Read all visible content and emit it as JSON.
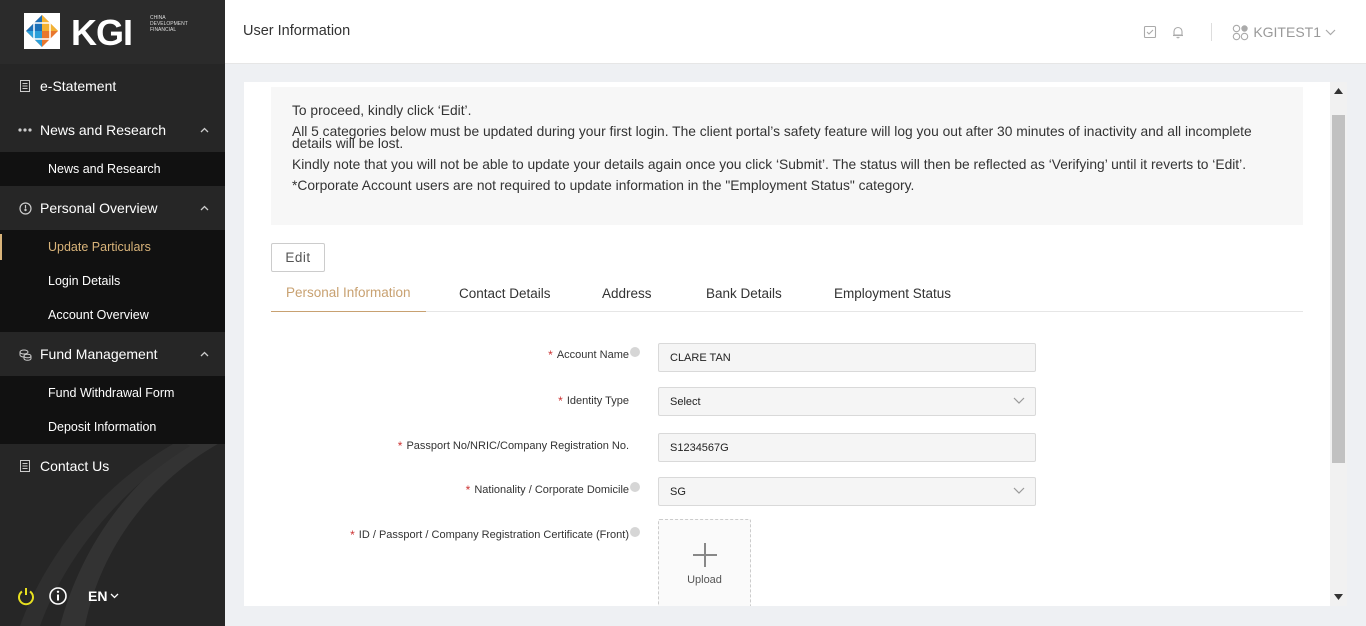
{
  "brand": {
    "name": "KGI",
    "subtitle": "CHINA DEVELOPMENT FINANCIAL"
  },
  "header": {
    "title": "User Information",
    "username": "KGITEST1"
  },
  "sidebar": {
    "items": [
      {
        "label": "e-Statement",
        "icon": "document-icon"
      },
      {
        "label": "News and Research",
        "icon": "dots-icon",
        "expanded": true,
        "children": [
          "News and Research"
        ]
      },
      {
        "label": "Personal Overview",
        "icon": "gauge-icon",
        "expanded": true,
        "children": [
          "Update Particulars",
          "Login Details",
          "Account Overview"
        ],
        "active_child": "Update Particulars"
      },
      {
        "label": "Fund Management",
        "icon": "coins-icon",
        "expanded": true,
        "children": [
          "Fund Withdrawal Form",
          "Deposit Information"
        ]
      },
      {
        "label": "Contact Us",
        "icon": "document-icon"
      }
    ],
    "footer": {
      "language": "EN"
    }
  },
  "notice": {
    "line1": "To proceed, kindly click ‘Edit’.",
    "line2": "All 5 categories below must be updated during your first login. The client portal’s safety feature will log you out after 30 minutes of inactivity and all incomplete details will be lost.",
    "line3": "Kindly note that you will not be able to update your details again once you click ‘Submit’. The status will then be reflected as ‘Verifying’ until it reverts to ‘Edit’.",
    "line4": "*Corporate Account users are not required to update information in the \"Employment Status\" category."
  },
  "edit_label": "Edit",
  "tabs": [
    {
      "label": "Personal Information",
      "active": true
    },
    {
      "label": "Contact Details"
    },
    {
      "label": "Address"
    },
    {
      "label": "Bank Details"
    },
    {
      "label": "Employment Status"
    }
  ],
  "form": {
    "account_name": {
      "label": "Account Name",
      "value": "CLARE TAN"
    },
    "identity_type": {
      "label": "Identity Type",
      "value": "Select"
    },
    "passport_no": {
      "label": "Passport No/NRIC/Company Registration No.",
      "value": "S1234567G"
    },
    "nationality": {
      "label": "Nationality / Corporate Domicile",
      "value": "SG"
    },
    "id_front": {
      "label": "ID / Passport / Company Registration Certificate (Front)"
    },
    "upload_label": "Upload"
  },
  "colors": {
    "accent": "#c8a171",
    "sidebar_bg": "#262626",
    "submenu_bg": "#111111",
    "required": "#cc3333"
  }
}
